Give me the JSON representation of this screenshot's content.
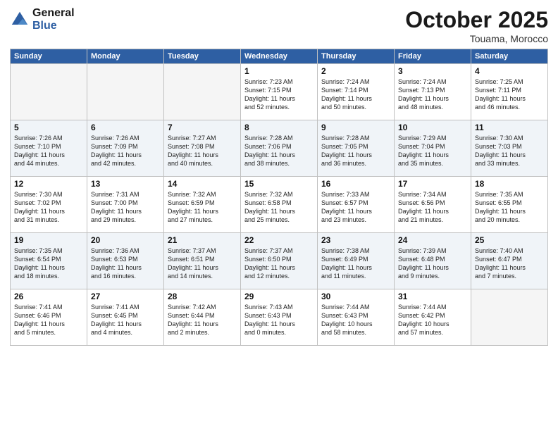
{
  "logo": {
    "line1": "General",
    "line2": "Blue"
  },
  "header": {
    "month": "October 2025",
    "location": "Touama, Morocco"
  },
  "weekdays": [
    "Sunday",
    "Monday",
    "Tuesday",
    "Wednesday",
    "Thursday",
    "Friday",
    "Saturday"
  ],
  "weeks": [
    [
      {
        "day": "",
        "empty": true
      },
      {
        "day": "",
        "empty": true
      },
      {
        "day": "",
        "empty": true
      },
      {
        "day": "1",
        "info": "Sunrise: 7:23 AM\nSunset: 7:15 PM\nDaylight: 11 hours\nand 52 minutes."
      },
      {
        "day": "2",
        "info": "Sunrise: 7:24 AM\nSunset: 7:14 PM\nDaylight: 11 hours\nand 50 minutes."
      },
      {
        "day": "3",
        "info": "Sunrise: 7:24 AM\nSunset: 7:13 PM\nDaylight: 11 hours\nand 48 minutes."
      },
      {
        "day": "4",
        "info": "Sunrise: 7:25 AM\nSunset: 7:11 PM\nDaylight: 11 hours\nand 46 minutes."
      }
    ],
    [
      {
        "day": "5",
        "info": "Sunrise: 7:26 AM\nSunset: 7:10 PM\nDaylight: 11 hours\nand 44 minutes."
      },
      {
        "day": "6",
        "info": "Sunrise: 7:26 AM\nSunset: 7:09 PM\nDaylight: 11 hours\nand 42 minutes."
      },
      {
        "day": "7",
        "info": "Sunrise: 7:27 AM\nSunset: 7:08 PM\nDaylight: 11 hours\nand 40 minutes."
      },
      {
        "day": "8",
        "info": "Sunrise: 7:28 AM\nSunset: 7:06 PM\nDaylight: 11 hours\nand 38 minutes."
      },
      {
        "day": "9",
        "info": "Sunrise: 7:28 AM\nSunset: 7:05 PM\nDaylight: 11 hours\nand 36 minutes."
      },
      {
        "day": "10",
        "info": "Sunrise: 7:29 AM\nSunset: 7:04 PM\nDaylight: 11 hours\nand 35 minutes."
      },
      {
        "day": "11",
        "info": "Sunrise: 7:30 AM\nSunset: 7:03 PM\nDaylight: 11 hours\nand 33 minutes."
      }
    ],
    [
      {
        "day": "12",
        "info": "Sunrise: 7:30 AM\nSunset: 7:02 PM\nDaylight: 11 hours\nand 31 minutes."
      },
      {
        "day": "13",
        "info": "Sunrise: 7:31 AM\nSunset: 7:00 PM\nDaylight: 11 hours\nand 29 minutes."
      },
      {
        "day": "14",
        "info": "Sunrise: 7:32 AM\nSunset: 6:59 PM\nDaylight: 11 hours\nand 27 minutes."
      },
      {
        "day": "15",
        "info": "Sunrise: 7:32 AM\nSunset: 6:58 PM\nDaylight: 11 hours\nand 25 minutes."
      },
      {
        "day": "16",
        "info": "Sunrise: 7:33 AM\nSunset: 6:57 PM\nDaylight: 11 hours\nand 23 minutes."
      },
      {
        "day": "17",
        "info": "Sunrise: 7:34 AM\nSunset: 6:56 PM\nDaylight: 11 hours\nand 21 minutes."
      },
      {
        "day": "18",
        "info": "Sunrise: 7:35 AM\nSunset: 6:55 PM\nDaylight: 11 hours\nand 20 minutes."
      }
    ],
    [
      {
        "day": "19",
        "info": "Sunrise: 7:35 AM\nSunset: 6:54 PM\nDaylight: 11 hours\nand 18 minutes."
      },
      {
        "day": "20",
        "info": "Sunrise: 7:36 AM\nSunset: 6:53 PM\nDaylight: 11 hours\nand 16 minutes."
      },
      {
        "day": "21",
        "info": "Sunrise: 7:37 AM\nSunset: 6:51 PM\nDaylight: 11 hours\nand 14 minutes."
      },
      {
        "day": "22",
        "info": "Sunrise: 7:37 AM\nSunset: 6:50 PM\nDaylight: 11 hours\nand 12 minutes."
      },
      {
        "day": "23",
        "info": "Sunrise: 7:38 AM\nSunset: 6:49 PM\nDaylight: 11 hours\nand 11 minutes."
      },
      {
        "day": "24",
        "info": "Sunrise: 7:39 AM\nSunset: 6:48 PM\nDaylight: 11 hours\nand 9 minutes."
      },
      {
        "day": "25",
        "info": "Sunrise: 7:40 AM\nSunset: 6:47 PM\nDaylight: 11 hours\nand 7 minutes."
      }
    ],
    [
      {
        "day": "26",
        "info": "Sunrise: 7:41 AM\nSunset: 6:46 PM\nDaylight: 11 hours\nand 5 minutes."
      },
      {
        "day": "27",
        "info": "Sunrise: 7:41 AM\nSunset: 6:45 PM\nDaylight: 11 hours\nand 4 minutes."
      },
      {
        "day": "28",
        "info": "Sunrise: 7:42 AM\nSunset: 6:44 PM\nDaylight: 11 hours\nand 2 minutes."
      },
      {
        "day": "29",
        "info": "Sunrise: 7:43 AM\nSunset: 6:43 PM\nDaylight: 11 hours\nand 0 minutes."
      },
      {
        "day": "30",
        "info": "Sunrise: 7:44 AM\nSunset: 6:43 PM\nDaylight: 10 hours\nand 58 minutes."
      },
      {
        "day": "31",
        "info": "Sunrise: 7:44 AM\nSunset: 6:42 PM\nDaylight: 10 hours\nand 57 minutes."
      },
      {
        "day": "",
        "empty": true
      }
    ]
  ]
}
